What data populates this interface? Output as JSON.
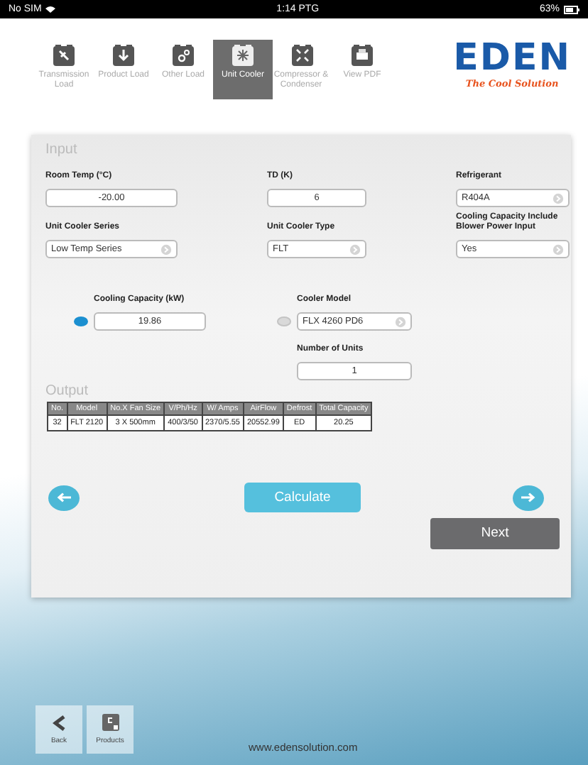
{
  "status_bar": {
    "carrier": "No SIM",
    "time": "1:14 PTG",
    "battery": "63%"
  },
  "nav": {
    "items": [
      {
        "label": "Transmission Load",
        "selected": false
      },
      {
        "label": "Product Load",
        "selected": false
      },
      {
        "label": "Other Load",
        "selected": false
      },
      {
        "label": "Unit Cooler",
        "selected": true
      },
      {
        "label": "Compressor & Condenser",
        "selected": false
      },
      {
        "label": "View PDF",
        "selected": false
      }
    ]
  },
  "logo": {
    "name": "EDEN",
    "tagline": "The Cool Solution"
  },
  "input": {
    "heading": "Input",
    "fields": [
      {
        "label": "Room Temp (°C)",
        "value": "-20.00",
        "kind": "text"
      },
      {
        "label": "TD (K)",
        "value": "6",
        "kind": "text"
      },
      {
        "label": "Refrigerant",
        "value": "R404A",
        "kind": "select"
      },
      {
        "label": "Unit Cooler Series",
        "value": "Low Temp Series",
        "kind": "select"
      },
      {
        "label": "Unit Cooler Type",
        "value": "FLT",
        "kind": "select"
      },
      {
        "label": "Cooling Capacity Include Blower Power Input",
        "value": "Yes",
        "kind": "select"
      }
    ],
    "modes": [
      {
        "label": "Cooling Capacity (kW)",
        "value": "19.86",
        "kind": "text",
        "selected": true
      },
      {
        "label": "Cooler Model",
        "value": "FLX 4260 PD6",
        "kind": "select",
        "selected": false
      }
    ],
    "units": {
      "label": "Number of Units",
      "value": "1"
    }
  },
  "output": {
    "heading": "Output",
    "columns": [
      "No.",
      "Model",
      "No.X Fan Size",
      "V/Ph/Hz",
      "W/ Amps",
      "AirFlow",
      "Defrost",
      "Total Capacity"
    ],
    "rows": [
      [
        "32",
        "FLT 2120",
        "3 X 500mm",
        "400/3/50",
        "2370/5.55",
        "20552.99",
        "ED",
        "20.25"
      ]
    ]
  },
  "actions": {
    "calculate": "Calculate",
    "next": "Next"
  },
  "footer": {
    "items": [
      {
        "label": "Back",
        "kind": "back"
      },
      {
        "label": "Products",
        "kind": "products"
      }
    ],
    "url": "www.edensolution.com"
  }
}
